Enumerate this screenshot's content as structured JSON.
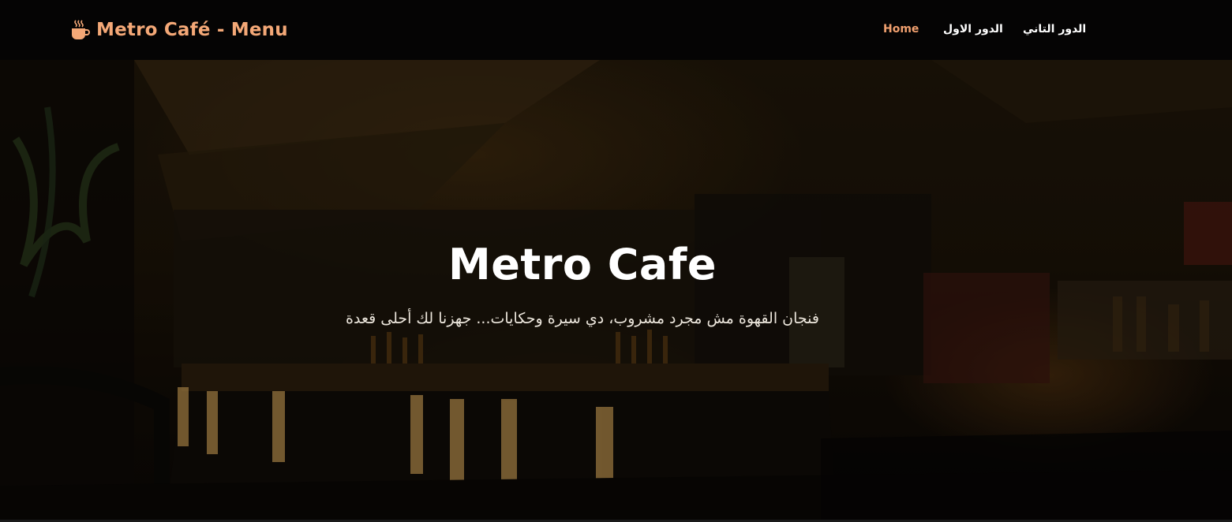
{
  "navbar": {
    "brand_icon": "coffee-cup-icon",
    "brand_text": "Metro Café - Menu",
    "brand_color": "#f4a877",
    "links": [
      {
        "label": "Home",
        "active": true
      },
      {
        "label": "الدور الاول",
        "active": false
      },
      {
        "label": "الدور التاني",
        "active": false
      }
    ],
    "active_color": "#f1a06f"
  },
  "hero": {
    "title": "Metro Cafe",
    "subtitle": "فنجان القهوة مش مجرد مشروب، دي سيرة وحكايات... جهزنا لك أحلى قعدة",
    "background": "dark-cafe-interior-photo"
  }
}
